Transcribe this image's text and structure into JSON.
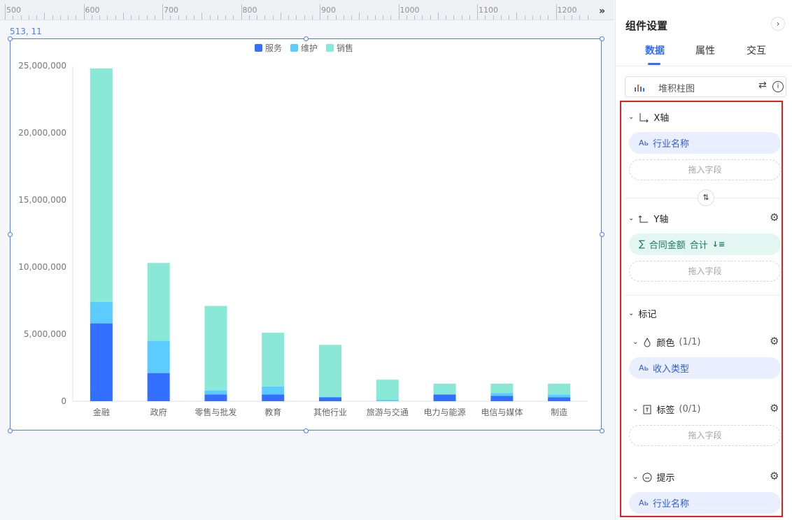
{
  "ruler": {
    "labels": [
      "500",
      "600",
      "700",
      "800",
      "900",
      "1000",
      "1100",
      "1200"
    ]
  },
  "expand_icon": "double-chevron-right",
  "coord_readout": "513, 11",
  "chart_data": {
    "type": "bar",
    "stacked": true,
    "categories": [
      "金融",
      "政府",
      "零售与批发",
      "教育",
      "其他行业",
      "旅游与交通",
      "电力与能源",
      "电信与媒体",
      "制造"
    ],
    "series": [
      {
        "name": "服务",
        "color": "#3370ff",
        "values": [
          5800000,
          2100000,
          500000,
          500000,
          300000,
          0,
          500000,
          400000,
          300000
        ]
      },
      {
        "name": "维护",
        "color": "#5ccbfe",
        "values": [
          1600000,
          2400000,
          300000,
          600000,
          0,
          100000,
          0,
          200000,
          200000
        ]
      },
      {
        "name": "销售",
        "color": "#8ae8d7",
        "values": [
          17400000,
          5800000,
          6300000,
          4000000,
          3900000,
          1500000,
          800000,
          700000,
          800000
        ]
      }
    ],
    "yticks": [
      "0",
      "5,000,000",
      "10,000,000",
      "15,000,000",
      "20,000,000",
      "25,000,000"
    ],
    "ylim": [
      0,
      25000000
    ],
    "grid": false,
    "legend": "top-center"
  },
  "panel": {
    "title": "组件设置",
    "close_icon": "chevron-right",
    "tabs": [
      "数据",
      "属性",
      "交互"
    ],
    "active_tab": "数据",
    "chart_type": "堆积柱图",
    "x_axis": {
      "label": "X轴",
      "field": "行业名称",
      "drop_hint": "拖入字段"
    },
    "swap_icon": "swap-vertical",
    "y_axis": {
      "label": "Y轴",
      "field": "合同金额",
      "agg": "合计",
      "drop_hint": "拖入字段"
    },
    "marks": {
      "label": "标记",
      "color": {
        "label": "颜色",
        "count": "(1/1)",
        "field": "收入类型"
      },
      "tag": {
        "label": "标签",
        "count": "(0/1)",
        "drop_hint": "拖入字段"
      },
      "tooltip": {
        "label": "提示",
        "field": "行业名称"
      }
    },
    "highlight_color": "#e02020",
    "accent": "#2f6bff"
  }
}
